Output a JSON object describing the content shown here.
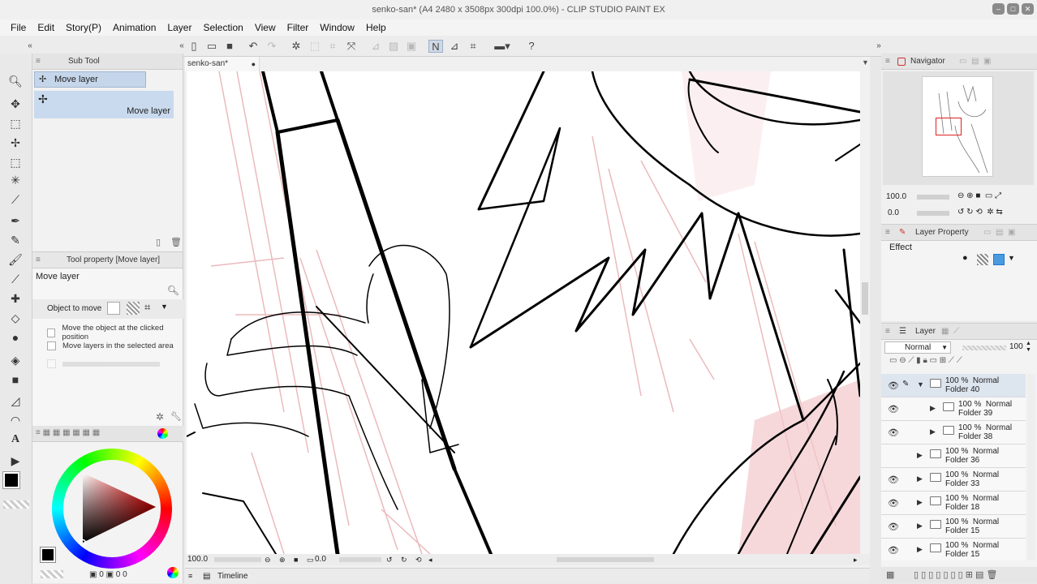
{
  "window": {
    "title": "senko-san* (A4 2480 x 3508px 300dpi 100.0%) - CLIP STUDIO PAINT EX",
    "buttons": [
      "minimize-icon",
      "maximize-icon",
      "close-icon"
    ]
  },
  "menu": [
    "File",
    "Edit",
    "Story(P)",
    "Animation",
    "Layer",
    "Selection",
    "View",
    "Filter",
    "Window",
    "Help"
  ],
  "subtool": {
    "title": "Sub Tool",
    "group_label": "Move layer",
    "item_label": "Move layer"
  },
  "tool_property": {
    "title": "Tool property [Move layer]",
    "tool_name": "Move layer",
    "object_to_move_label": "Object to move",
    "options": [
      "Move the object at the clicked position",
      "Move layers in the selected area"
    ]
  },
  "canvas": {
    "tab_label": "senko-san*",
    "zoom_value": "100.0",
    "angle_value": "0.0"
  },
  "timeline": {
    "label": "Timeline"
  },
  "navigator": {
    "title": "Navigator",
    "zoom_value": "100.0",
    "angle_value": "0.0"
  },
  "layer_property": {
    "title": "Layer Property",
    "effect_label": "Effect"
  },
  "layer_panel": {
    "title": "Layer",
    "blend_mode": "Normal",
    "opacity": "100",
    "layers": [
      {
        "opacity": "100 %",
        "mode": "Normal",
        "name": "Folder 40",
        "visible": true,
        "indent": 0,
        "selected": true,
        "expanded": true
      },
      {
        "opacity": "100 %",
        "mode": "Normal",
        "name": "Folder 39",
        "visible": true,
        "indent": 1,
        "selected": false,
        "expanded": false
      },
      {
        "opacity": "100 %",
        "mode": "Normal",
        "name": "Folder 38",
        "visible": true,
        "indent": 1,
        "selected": false,
        "expanded": false
      },
      {
        "opacity": "100 %",
        "mode": "Normal",
        "name": "Folder 36",
        "visible": false,
        "indent": 0,
        "selected": false,
        "expanded": false
      },
      {
        "opacity": "100 %",
        "mode": "Normal",
        "name": "Folder 33",
        "visible": true,
        "indent": 0,
        "selected": false,
        "expanded": false
      },
      {
        "opacity": "100 %",
        "mode": "Normal",
        "name": "Folder 18",
        "visible": true,
        "indent": 0,
        "selected": false,
        "expanded": false
      },
      {
        "opacity": "100 %",
        "mode": "Normal",
        "name": "Folder 15",
        "visible": true,
        "indent": 0,
        "selected": false,
        "expanded": false
      },
      {
        "opacity": "100 %",
        "mode": "Normal",
        "name": "Folder 15",
        "visible": true,
        "indent": 0,
        "selected": false,
        "expanded": false
      }
    ]
  },
  "colors": {
    "foreground": "#000000",
    "background": "#ffffff",
    "selection": "#dde5ef"
  }
}
